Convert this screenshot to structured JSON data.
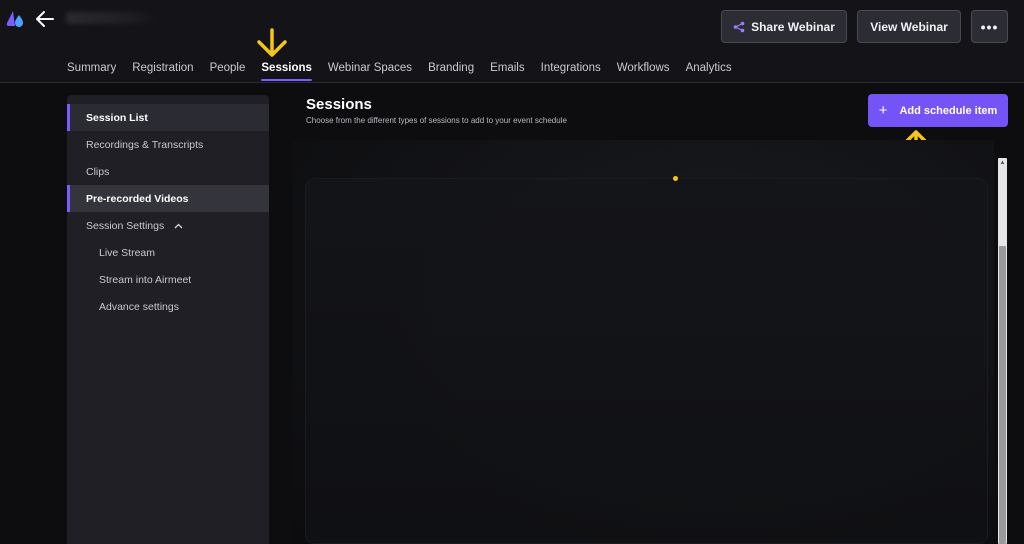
{
  "header": {
    "share_button": "Share Webinar",
    "view_button": "View Webinar",
    "more_button": "•••"
  },
  "tabs": [
    {
      "label": "Summary"
    },
    {
      "label": "Registration"
    },
    {
      "label": "People"
    },
    {
      "label": "Sessions"
    },
    {
      "label": "Webinar Spaces"
    },
    {
      "label": "Branding"
    },
    {
      "label": "Emails"
    },
    {
      "label": "Integrations"
    },
    {
      "label": "Workflows"
    },
    {
      "label": "Analytics"
    }
  ],
  "sidebar": {
    "items": [
      {
        "label": "Session List"
      },
      {
        "label": "Recordings & Transcripts"
      },
      {
        "label": "Clips"
      },
      {
        "label": "Pre-recorded Videos"
      },
      {
        "label": "Session Settings"
      },
      {
        "label": "Live Stream"
      },
      {
        "label": "Stream into Airmeet"
      },
      {
        "label": "Advance settings"
      }
    ]
  },
  "main": {
    "title": "Sessions",
    "subtitle": "Choose from the different types of sessions to add to your event schedule",
    "add_button": "Add schedule item"
  },
  "colors": {
    "accent": "#7554f7",
    "annotation": "#f5c518",
    "background": "#0d0d10",
    "sidebar": "#1f1f25"
  }
}
